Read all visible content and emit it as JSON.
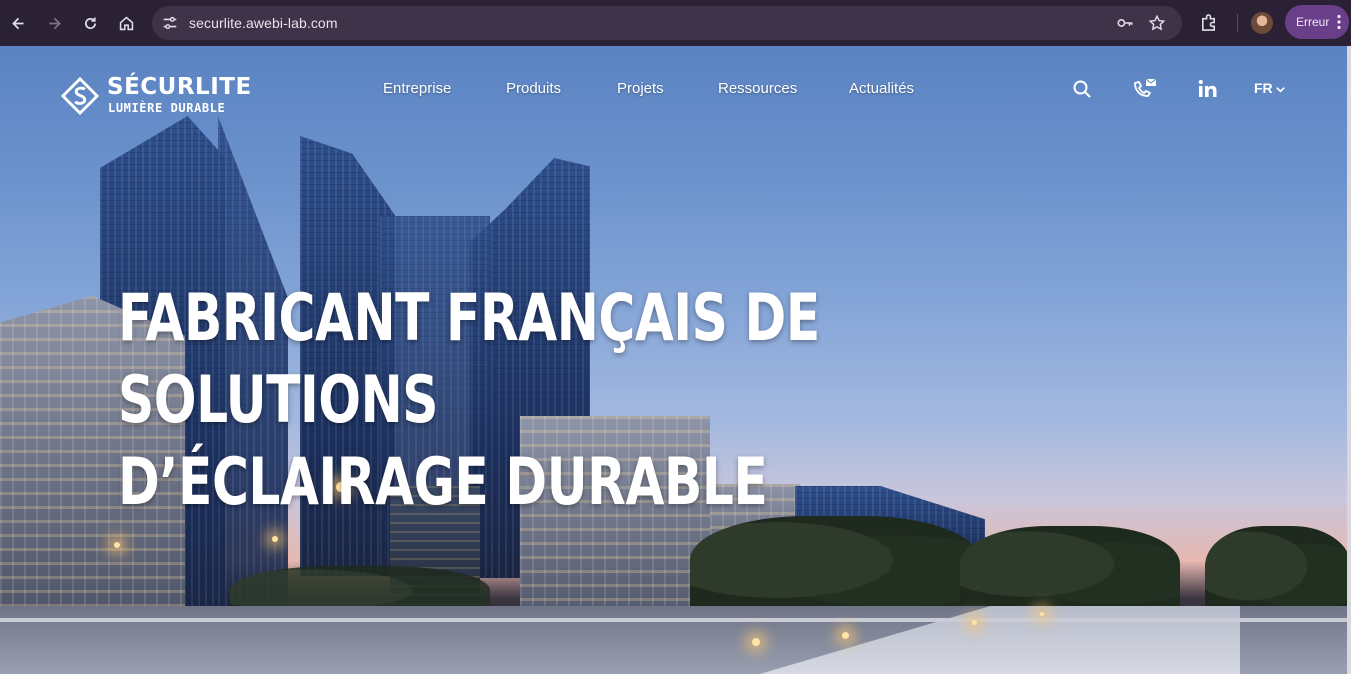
{
  "browser": {
    "url": "securlite.awebi-lab.com",
    "error_label": "Erreur",
    "icons": [
      "back-icon",
      "forward-icon",
      "reload-icon",
      "home-icon",
      "site-info-icon",
      "password-key-icon",
      "bookmark-star-icon",
      "extensions-icon",
      "profile-avatar",
      "menu-dots-icon"
    ]
  },
  "site": {
    "logo": {
      "name": "SÉCURLITE",
      "tagline": "LUMIÈRE DURABLE"
    },
    "nav": [
      "Entreprise",
      "Produits",
      "Projets",
      "Ressources",
      "Actualités"
    ],
    "header_icons": [
      "search-icon",
      "phone-mail-icon",
      "linkedin-icon"
    ],
    "language": "FR",
    "hero": {
      "line1": "FABRICANT FRANÇAIS DE SOLUTIONS",
      "line2": "D’ÉCLAIRAGE DURABLE"
    }
  },
  "colors": {
    "chrome_bg": "#2b2134",
    "omnibox_bg": "#3e3348",
    "error_pill": "#6a3f8a",
    "sky_top": "#5a83c2"
  }
}
